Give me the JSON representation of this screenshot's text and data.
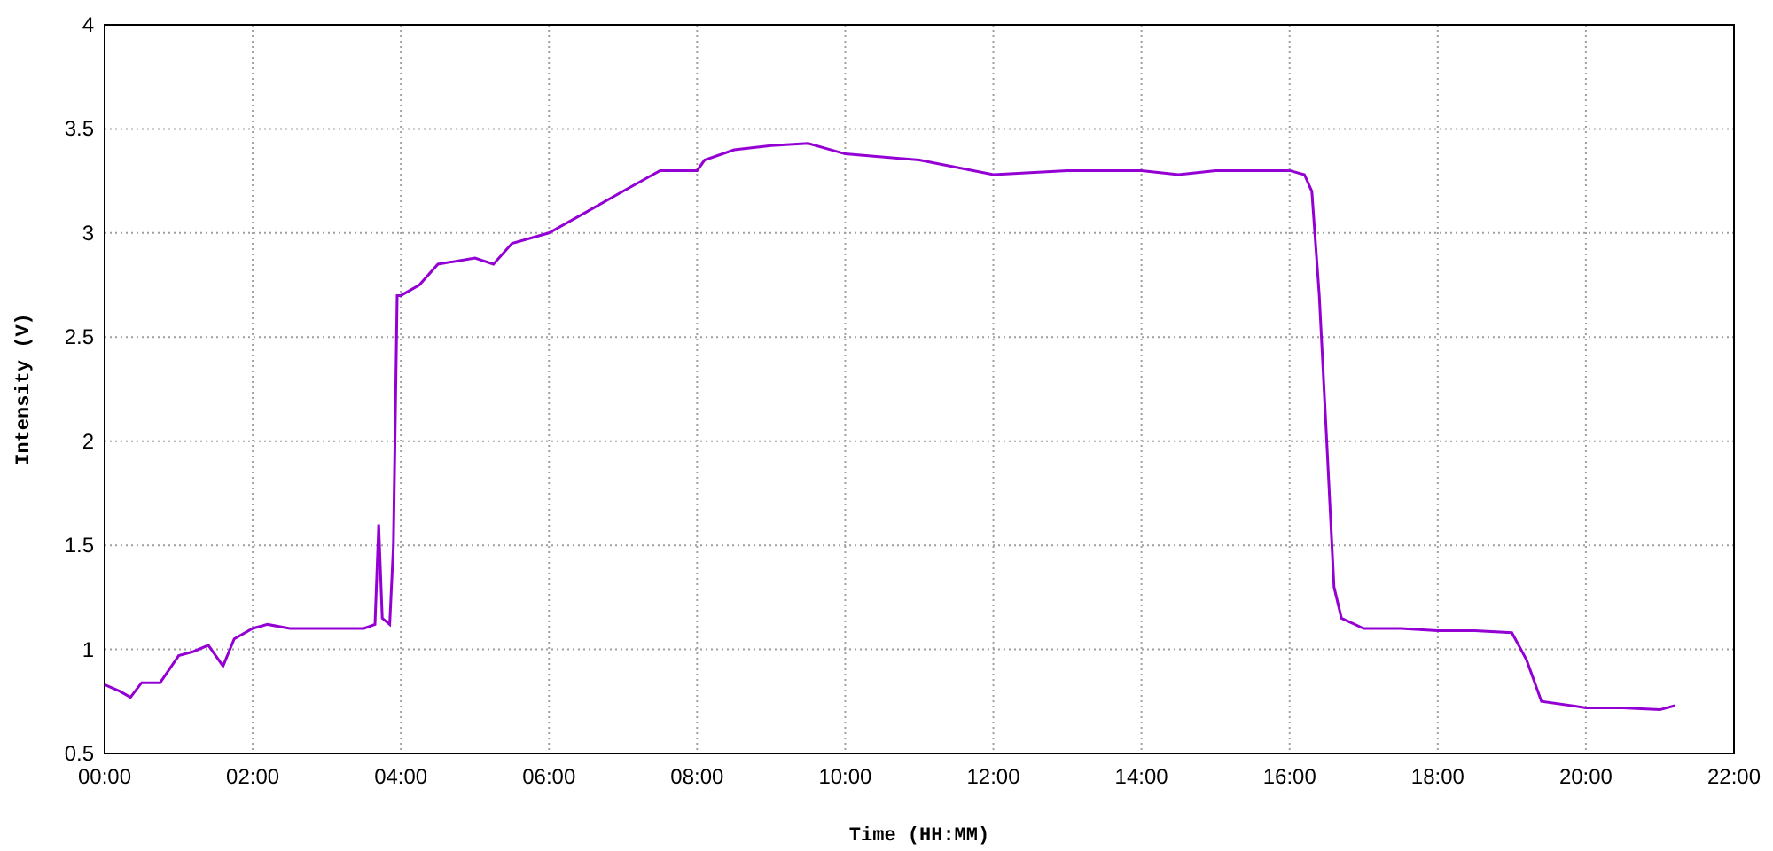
{
  "chart_data": {
    "type": "line",
    "grid": true,
    "xlabel": "Time (HH:MM)",
    "ylabel": "Intensity (V)",
    "xlim": [
      0,
      22
    ],
    "ylim": [
      0.5,
      4
    ],
    "xticks": [
      {
        "value": 0,
        "label": "00:00"
      },
      {
        "value": 2,
        "label": "02:00"
      },
      {
        "value": 4,
        "label": "04:00"
      },
      {
        "value": 6,
        "label": "06:00"
      },
      {
        "value": 8,
        "label": "08:00"
      },
      {
        "value": 10,
        "label": "10:00"
      },
      {
        "value": 12,
        "label": "12:00"
      },
      {
        "value": 14,
        "label": "14:00"
      },
      {
        "value": 16,
        "label": "16:00"
      },
      {
        "value": 18,
        "label": "18:00"
      },
      {
        "value": 20,
        "label": "20:00"
      },
      {
        "value": 22,
        "label": "22:00"
      }
    ],
    "yticks": [
      {
        "value": 0.5,
        "label": "0.5"
      },
      {
        "value": 1,
        "label": "1"
      },
      {
        "value": 1.5,
        "label": "1.5"
      },
      {
        "value": 2,
        "label": "2"
      },
      {
        "value": 2.5,
        "label": "2.5"
      },
      {
        "value": 3,
        "label": "3"
      },
      {
        "value": 3.5,
        "label": "3.5"
      },
      {
        "value": 4,
        "label": "4"
      }
    ],
    "x": [
      0,
      0.2,
      0.35,
      0.5,
      0.75,
      1.0,
      1.2,
      1.4,
      1.6,
      1.75,
      2.0,
      2.2,
      2.5,
      3.0,
      3.5,
      3.65,
      3.7,
      3.75,
      3.85,
      3.9,
      3.95,
      4.0,
      4.25,
      4.5,
      5.0,
      5.25,
      5.5,
      6.0,
      6.5,
      7.0,
      7.5,
      8.0,
      8.1,
      8.5,
      9.0,
      9.5,
      10,
      11,
      12,
      13,
      14,
      14.5,
      15,
      15.5,
      16,
      16.2,
      16.3,
      16.4,
      16.5,
      16.6,
      16.7,
      17,
      17.5,
      18,
      18.5,
      19,
      19.2,
      19.4,
      20,
      20.5,
      21,
      21.2
    ],
    "series": [
      {
        "color": "#9400d3",
        "values": [
          0.83,
          0.8,
          0.77,
          0.84,
          0.84,
          0.97,
          0.99,
          1.02,
          0.92,
          1.05,
          1.1,
          1.12,
          1.1,
          1.1,
          1.1,
          1.12,
          1.6,
          1.15,
          1.12,
          1.5,
          2.7,
          2.7,
          2.75,
          2.85,
          2.88,
          2.85,
          2.95,
          3.0,
          3.1,
          3.2,
          3.3,
          3.3,
          3.35,
          3.4,
          3.42,
          3.43,
          3.38,
          3.35,
          3.28,
          3.3,
          3.3,
          3.28,
          3.3,
          3.3,
          3.3,
          3.28,
          3.2,
          2.7,
          2.0,
          1.3,
          1.15,
          1.1,
          1.1,
          1.09,
          1.09,
          1.08,
          0.95,
          0.75,
          0.72,
          0.72,
          0.71,
          0.73
        ]
      }
    ]
  }
}
